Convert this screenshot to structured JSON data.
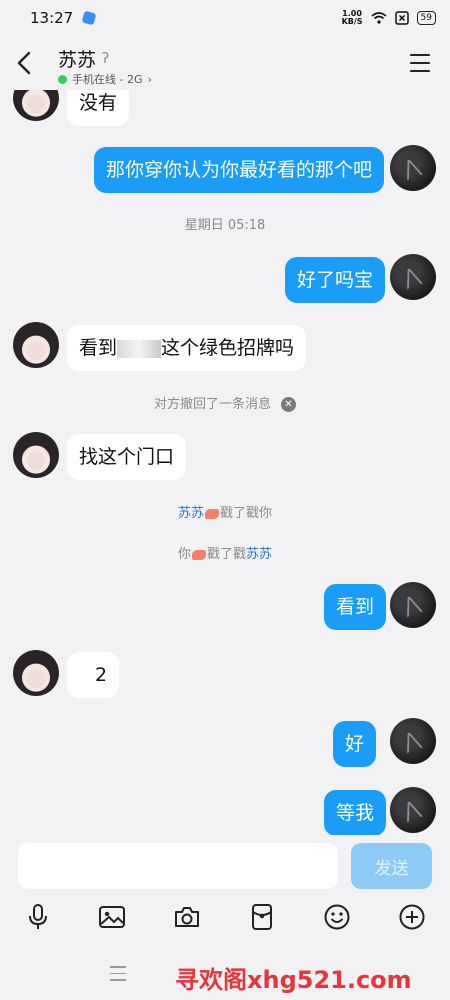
{
  "status_bar": {
    "time": "13:27",
    "speed_value": "1.00",
    "speed_unit": "KB/S",
    "battery": "59"
  },
  "header": {
    "contact_name": "苏苏",
    "status": "手机在线 - 2G",
    "ear_icon": "ear-icon",
    "menu_icon": "hamburger-icon"
  },
  "messages": {
    "m1": "没有",
    "m2": "那你穿你认为你最好看的那个吧",
    "time_divider": "星期日 05:18",
    "m3": "好了吗宝",
    "m4_prefix": "看到",
    "m4_suffix": "这个绿色招牌吗",
    "recall_notice": "对方撤回了一条消息",
    "m5": "找这个门口",
    "poke1_name": "苏苏",
    "poke1_text": "戳了戳你",
    "poke2_prefix": "你",
    "poke2_text": "戳了戳",
    "poke2_name": "苏苏",
    "m6": "看到",
    "m7_text": "2",
    "m8": "好",
    "m9": "等我"
  },
  "input_bar": {
    "placeholder": "",
    "send_label": "发送"
  },
  "toolbar_icons": [
    "microphone-icon",
    "image-icon",
    "camera-icon",
    "red-packet-icon",
    "emoji-icon",
    "plus-icon"
  ],
  "watermark": "寻欢阁xhg521.com",
  "colors": {
    "bubble_blue": "#1a9df6",
    "online_green": "#2fd15b",
    "name_link": "#2b72c8",
    "send_disabled": "#8dcbf6"
  }
}
